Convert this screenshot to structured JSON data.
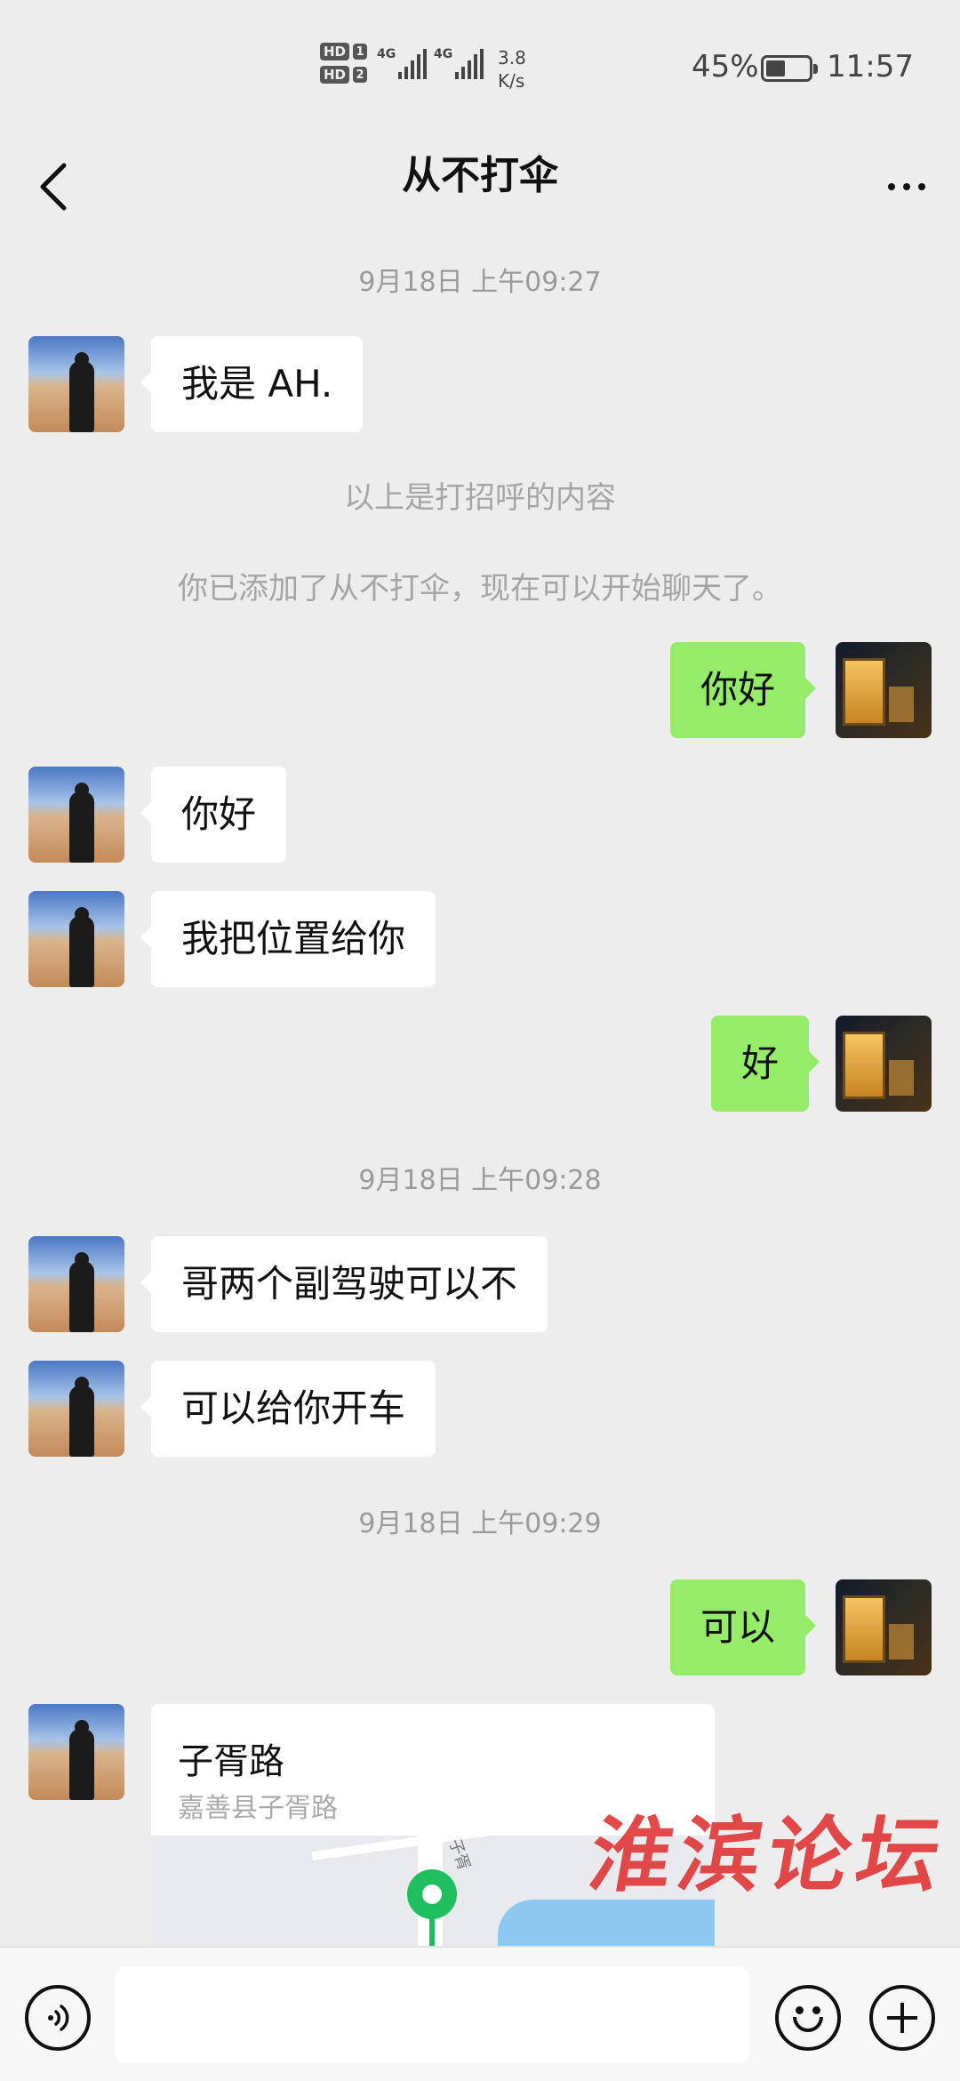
{
  "status_bar": {
    "hd1": "HD",
    "hd1_num": "1",
    "hd2": "HD",
    "hd2_num": "2",
    "signal1": "4G",
    "signal2": "4G",
    "net_speed_value": "3.8",
    "net_speed_unit": "K/s",
    "battery_percent": "45%",
    "battery_level": 0.45,
    "time": "11:57"
  },
  "header": {
    "title": "从不打伞",
    "back_icon": "chevron-left-icon",
    "more_icon": "more-dots-icon"
  },
  "messages": {
    "ts1": "9月18日 上午09:27",
    "m1": "我是 AH.",
    "note1": "以上是打招呼的内容",
    "note2": "你已添加了从不打伞，现在可以开始聊天了。",
    "m2": "你好",
    "m3": "你好",
    "m4": "我把位置给你",
    "m5": "好",
    "ts2": "9月18日 上午09:28",
    "m6": "哥两个副驾驶可以不",
    "m7": "可以给你开车",
    "ts3": "9月18日 上午09:29",
    "m8": "可以",
    "location": {
      "title": "子胥路",
      "address": "嘉善县子胥路",
      "road_label": "子胥"
    }
  },
  "watermark": "淮滨论坛",
  "input_bar": {
    "voice_icon": "voice-icon",
    "emoji_icon": "emoji-icon",
    "plus_icon": "plus-icon",
    "input_value": ""
  },
  "colors": {
    "background": "#ededed",
    "bubble_sent": "#95ec69",
    "bubble_received": "#ffffff",
    "map_pin": "#1fbe5e",
    "watermark": "#e03a3a"
  }
}
